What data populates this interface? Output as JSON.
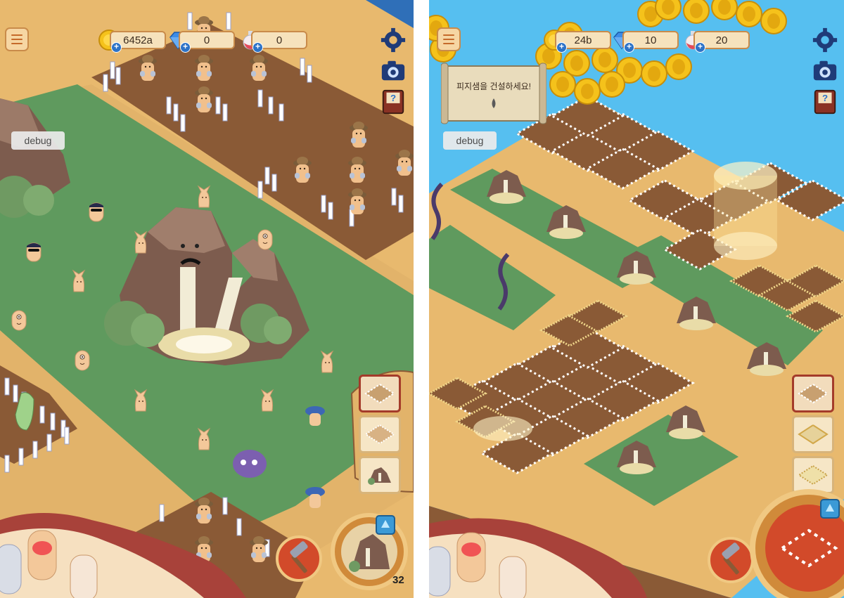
{
  "left": {
    "resources": {
      "gold": "6452a",
      "gems": "0",
      "potions": "0"
    },
    "debug_label": "debug",
    "corner_count": "32",
    "build_menu": {
      "slots": [
        "fence-plot",
        "fence-plot-round",
        "rock-fountain"
      ],
      "active_index": 0
    },
    "icons": {
      "menu": "hamburger-menu-icon",
      "settings": "gear-icon",
      "camera": "camera-icon",
      "help": "help-book-icon",
      "hammer": "hammer-icon",
      "up": "arrow-up-icon"
    }
  },
  "right": {
    "resources": {
      "gold": "24b",
      "gems": "10",
      "potions": "20"
    },
    "debug_label": "debug",
    "quest_text": "피지샘을 건설하세요!",
    "build_menu": {
      "slots": [
        "fence-plot",
        "field-plot",
        "hay-plot"
      ],
      "active_index": 0
    },
    "icons": {
      "menu": "hamburger-menu-icon",
      "settings": "gear-icon",
      "camera": "camera-icon",
      "help": "help-book-icon",
      "hammer": "hammer-icon",
      "up": "arrow-up-icon"
    }
  },
  "colors": {
    "sand": "#e8b96e",
    "grass": "#5f9a5e",
    "soil": "#8a5a36",
    "sky": "#56bff0",
    "rock": "#7d5c4e",
    "hud_border": "#c98b4a",
    "hud_fill": "#f6e2bc",
    "plus_blue": "#2d73c7",
    "frame_red": "#a43b2a"
  }
}
